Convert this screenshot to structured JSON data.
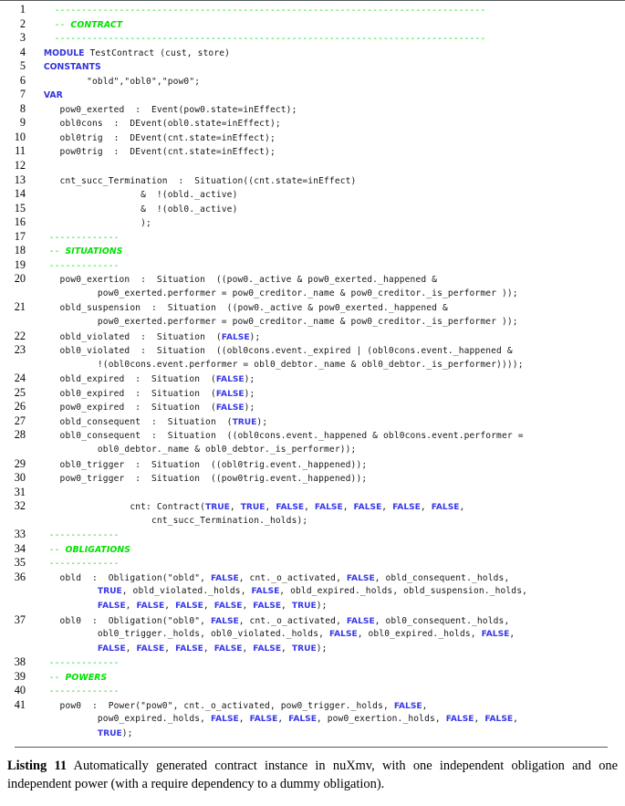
{
  "listing": {
    "language": "nuXmv",
    "colors": {
      "comment": "#00e000",
      "keyword": "#3333dd",
      "boolean": "#3838e8",
      "text": "#161616",
      "rule": "#555a5e",
      "background": "#ffffff"
    },
    "lines": [
      {
        "n": "1",
        "segments": [
          {
            "t": "    ",
            "c": "plain"
          },
          {
            "t": "--------------------------------------------------------------------------------",
            "c": "cmt"
          }
        ]
      },
      {
        "n": "2",
        "segments": [
          {
            "t": "    ",
            "c": "plain"
          },
          {
            "t": "--",
            "c": "cmt"
          },
          {
            "t": " ",
            "c": "plain"
          },
          {
            "t": "CONTRACT",
            "c": "cmt-it"
          }
        ]
      },
      {
        "n": "3",
        "segments": [
          {
            "t": "    ",
            "c": "plain"
          },
          {
            "t": "--------------------------------------------------------------------------------",
            "c": "cmt"
          }
        ]
      },
      {
        "n": "4",
        "segments": [
          {
            "t": "  ",
            "c": "plain"
          },
          {
            "t": "MODULE",
            "c": "kw"
          },
          {
            "t": " TestContract (cust, store)",
            "c": "plain"
          }
        ]
      },
      {
        "n": "5",
        "segments": [
          {
            "t": "  ",
            "c": "plain"
          },
          {
            "t": "CONSTANTS",
            "c": "kw"
          }
        ]
      },
      {
        "n": "6",
        "segments": [
          {
            "t": "          \"obld\",\"obl0\",\"pow0\";",
            "c": "plain"
          }
        ]
      },
      {
        "n": "7",
        "segments": [
          {
            "t": "  ",
            "c": "plain"
          },
          {
            "t": "VAR",
            "c": "kw"
          }
        ]
      },
      {
        "n": "8",
        "segments": [
          {
            "t": "     pow0_exerted  :  Event(pow0.state=inEffect);",
            "c": "plain"
          }
        ]
      },
      {
        "n": "9",
        "segments": [
          {
            "t": "     obl0cons  :  DEvent(obl0.state=inEffect);",
            "c": "plain"
          }
        ]
      },
      {
        "n": "10",
        "segments": [
          {
            "t": "     obl0trig  :  DEvent(cnt.state=inEffect);",
            "c": "plain"
          }
        ]
      },
      {
        "n": "11",
        "segments": [
          {
            "t": "     pow0trig  :  DEvent(cnt.state=inEffect);",
            "c": "plain"
          }
        ]
      },
      {
        "n": "12",
        "segments": [
          {
            "t": "",
            "c": "plain"
          }
        ]
      },
      {
        "n": "13",
        "segments": [
          {
            "t": "     cnt_succ_Termination  :  Situation((cnt.state=inEffect)",
            "c": "plain"
          }
        ]
      },
      {
        "n": "14",
        "segments": [
          {
            "t": "                    &  !(obld._active)",
            "c": "plain"
          }
        ]
      },
      {
        "n": "15",
        "segments": [
          {
            "t": "                    &  !(obl0._active)",
            "c": "plain"
          }
        ]
      },
      {
        "n": "16",
        "segments": [
          {
            "t": "                    );",
            "c": "plain"
          }
        ]
      },
      {
        "n": "17",
        "segments": [
          {
            "t": "   ",
            "c": "plain"
          },
          {
            "t": "-------------",
            "c": "cmt"
          }
        ]
      },
      {
        "n": "18",
        "segments": [
          {
            "t": "   ",
            "c": "plain"
          },
          {
            "t": "--",
            "c": "cmt"
          },
          {
            "t": " ",
            "c": "plain"
          },
          {
            "t": "SITUATIONS",
            "c": "cmt-it"
          }
        ]
      },
      {
        "n": "19",
        "segments": [
          {
            "t": "   ",
            "c": "plain"
          },
          {
            "t": "-------------",
            "c": "cmt"
          }
        ]
      },
      {
        "n": "20",
        "segments": [
          {
            "t": "     pow0_exertion  :  Situation  ((pow0._active & pow0_exerted._happened &",
            "c": "plain"
          }
        ]
      },
      {
        "n": "",
        "segments": [
          {
            "t": "            pow0_exerted.performer = pow0_creditor._name & pow0_creditor._is_performer ));",
            "c": "plain"
          }
        ]
      },
      {
        "n": "21",
        "segments": [
          {
            "t": "     obld_suspension  :  Situation  ((pow0._active & pow0_exerted._happened &",
            "c": "plain"
          }
        ]
      },
      {
        "n": "",
        "segments": [
          {
            "t": "            pow0_exerted.performer = pow0_creditor._name & pow0_creditor._is_performer ));",
            "c": "plain"
          }
        ]
      },
      {
        "n": "22",
        "segments": [
          {
            "t": "     obld_violated  :  Situation  (",
            "c": "plain"
          },
          {
            "t": "FALSE",
            "c": "bool"
          },
          {
            "t": ");",
            "c": "plain"
          }
        ]
      },
      {
        "n": "23",
        "segments": [
          {
            "t": "     obl0_violated  :  Situation  ((obl0cons.event._expired | (obl0cons.event._happened &",
            "c": "plain"
          }
        ]
      },
      {
        "n": "",
        "segments": [
          {
            "t": "            !(obl0cons.event.performer = obl0_debtor._name & obl0_debtor._is_performer))));",
            "c": "plain"
          }
        ]
      },
      {
        "n": "24",
        "segments": [
          {
            "t": "     obld_expired  :  Situation  (",
            "c": "plain"
          },
          {
            "t": "FALSE",
            "c": "bool"
          },
          {
            "t": ");",
            "c": "plain"
          }
        ]
      },
      {
        "n": "25",
        "segments": [
          {
            "t": "     obl0_expired  :  Situation  (",
            "c": "plain"
          },
          {
            "t": "FALSE",
            "c": "bool"
          },
          {
            "t": ");",
            "c": "plain"
          }
        ]
      },
      {
        "n": "26",
        "segments": [
          {
            "t": "     pow0_expired  :  Situation  (",
            "c": "plain"
          },
          {
            "t": "FALSE",
            "c": "bool"
          },
          {
            "t": ");",
            "c": "plain"
          }
        ]
      },
      {
        "n": "27",
        "segments": [
          {
            "t": "     obld_consequent  :  Situation  (",
            "c": "plain"
          },
          {
            "t": "TRUE",
            "c": "bool"
          },
          {
            "t": ");",
            "c": "plain"
          }
        ]
      },
      {
        "n": "28",
        "segments": [
          {
            "t": "     obl0_consequent  :  Situation  ((obl0cons.event._happened & obl0cons.event.performer =",
            "c": "plain"
          }
        ]
      },
      {
        "n": "",
        "segments": [
          {
            "t": "            obl0_debtor._name & obl0_debtor._is_performer));",
            "c": "plain"
          }
        ]
      },
      {
        "n": "29",
        "segments": [
          {
            "t": "     obl0_trigger  :  Situation  ((obl0trig.event._happened));",
            "c": "plain"
          }
        ]
      },
      {
        "n": "30",
        "segments": [
          {
            "t": "     pow0_trigger  :  Situation  ((pow0trig.event._happened));",
            "c": "plain"
          }
        ]
      },
      {
        "n": "31",
        "segments": [
          {
            "t": "",
            "c": "plain"
          }
        ]
      },
      {
        "n": "32",
        "segments": [
          {
            "t": "                  cnt: Contract(",
            "c": "plain"
          },
          {
            "t": "TRUE",
            "c": "bool"
          },
          {
            "t": ", ",
            "c": "plain"
          },
          {
            "t": "TRUE",
            "c": "bool"
          },
          {
            "t": ", ",
            "c": "plain"
          },
          {
            "t": "FALSE",
            "c": "bool"
          },
          {
            "t": ", ",
            "c": "plain"
          },
          {
            "t": "FALSE",
            "c": "bool"
          },
          {
            "t": ", ",
            "c": "plain"
          },
          {
            "t": "FALSE",
            "c": "bool"
          },
          {
            "t": ", ",
            "c": "plain"
          },
          {
            "t": "FALSE",
            "c": "bool"
          },
          {
            "t": ", ",
            "c": "plain"
          },
          {
            "t": "FALSE",
            "c": "bool"
          },
          {
            "t": ",",
            "c": "plain"
          }
        ]
      },
      {
        "n": "",
        "segments": [
          {
            "t": "                      cnt_succ_Termination._holds);",
            "c": "plain"
          }
        ]
      },
      {
        "n": "33",
        "segments": [
          {
            "t": "   ",
            "c": "plain"
          },
          {
            "t": "-------------",
            "c": "cmt"
          }
        ]
      },
      {
        "n": "34",
        "segments": [
          {
            "t": "   ",
            "c": "plain"
          },
          {
            "t": "--",
            "c": "cmt"
          },
          {
            "t": " ",
            "c": "plain"
          },
          {
            "t": "OBLIGATIONS",
            "c": "cmt-it"
          }
        ]
      },
      {
        "n": "35",
        "segments": [
          {
            "t": "   ",
            "c": "plain"
          },
          {
            "t": "-------------",
            "c": "cmt"
          }
        ]
      },
      {
        "n": "36",
        "segments": [
          {
            "t": "     obld  :  Obligation(\"obld\", ",
            "c": "plain"
          },
          {
            "t": "FALSE",
            "c": "bool"
          },
          {
            "t": ", cnt._o_activated, ",
            "c": "plain"
          },
          {
            "t": "FALSE",
            "c": "bool"
          },
          {
            "t": ", obld_consequent._holds,",
            "c": "plain"
          }
        ]
      },
      {
        "n": "",
        "segments": [
          {
            "t": "            ",
            "c": "plain"
          },
          {
            "t": "TRUE",
            "c": "bool"
          },
          {
            "t": ", obld_violated._holds, ",
            "c": "plain"
          },
          {
            "t": "FALSE",
            "c": "bool"
          },
          {
            "t": ", obld_expired._holds, obld_suspension._holds,",
            "c": "plain"
          }
        ]
      },
      {
        "n": "",
        "segments": [
          {
            "t": "            ",
            "c": "plain"
          },
          {
            "t": "FALSE",
            "c": "bool"
          },
          {
            "t": ", ",
            "c": "plain"
          },
          {
            "t": "FALSE",
            "c": "bool"
          },
          {
            "t": ", ",
            "c": "plain"
          },
          {
            "t": "FALSE",
            "c": "bool"
          },
          {
            "t": ", ",
            "c": "plain"
          },
          {
            "t": "FALSE",
            "c": "bool"
          },
          {
            "t": ", ",
            "c": "plain"
          },
          {
            "t": "FALSE",
            "c": "bool"
          },
          {
            "t": ", ",
            "c": "plain"
          },
          {
            "t": "TRUE",
            "c": "bool"
          },
          {
            "t": ");",
            "c": "plain"
          }
        ]
      },
      {
        "n": "37",
        "segments": [
          {
            "t": "     obl0  :  Obligation(\"obl0\", ",
            "c": "plain"
          },
          {
            "t": "FALSE",
            "c": "bool"
          },
          {
            "t": ", cnt._o_activated, ",
            "c": "plain"
          },
          {
            "t": "FALSE",
            "c": "bool"
          },
          {
            "t": ", obl0_consequent._holds,",
            "c": "plain"
          }
        ]
      },
      {
        "n": "",
        "segments": [
          {
            "t": "            obl0_trigger._holds, obl0_violated._holds, ",
            "c": "plain"
          },
          {
            "t": "FALSE",
            "c": "bool"
          },
          {
            "t": ", obl0_expired._holds, ",
            "c": "plain"
          },
          {
            "t": "FALSE",
            "c": "bool"
          },
          {
            "t": ",",
            "c": "plain"
          }
        ]
      },
      {
        "n": "",
        "segments": [
          {
            "t": "            ",
            "c": "plain"
          },
          {
            "t": "FALSE",
            "c": "bool"
          },
          {
            "t": ", ",
            "c": "plain"
          },
          {
            "t": "FALSE",
            "c": "bool"
          },
          {
            "t": ", ",
            "c": "plain"
          },
          {
            "t": "FALSE",
            "c": "bool"
          },
          {
            "t": ", ",
            "c": "plain"
          },
          {
            "t": "FALSE",
            "c": "bool"
          },
          {
            "t": ", ",
            "c": "plain"
          },
          {
            "t": "FALSE",
            "c": "bool"
          },
          {
            "t": ", ",
            "c": "plain"
          },
          {
            "t": "TRUE",
            "c": "bool"
          },
          {
            "t": ");",
            "c": "plain"
          }
        ]
      },
      {
        "n": "38",
        "segments": [
          {
            "t": "   ",
            "c": "plain"
          },
          {
            "t": "-------------",
            "c": "cmt"
          }
        ]
      },
      {
        "n": "39",
        "segments": [
          {
            "t": "   ",
            "c": "plain"
          },
          {
            "t": "--",
            "c": "cmt"
          },
          {
            "t": " ",
            "c": "plain"
          },
          {
            "t": "POWERS",
            "c": "cmt-it"
          }
        ]
      },
      {
        "n": "40",
        "segments": [
          {
            "t": "   ",
            "c": "plain"
          },
          {
            "t": "-------------",
            "c": "cmt"
          }
        ]
      },
      {
        "n": "41",
        "segments": [
          {
            "t": "     pow0  :  Power(\"pow0\", cnt._o_activated, pow0_trigger._holds, ",
            "c": "plain"
          },
          {
            "t": "FALSE",
            "c": "bool"
          },
          {
            "t": ",",
            "c": "plain"
          }
        ]
      },
      {
        "n": "",
        "segments": [
          {
            "t": "            pow0_expired._holds, ",
            "c": "plain"
          },
          {
            "t": "FALSE",
            "c": "bool"
          },
          {
            "t": ", ",
            "c": "plain"
          },
          {
            "t": "FALSE",
            "c": "bool"
          },
          {
            "t": ", ",
            "c": "plain"
          },
          {
            "t": "FALSE",
            "c": "bool"
          },
          {
            "t": ", pow0_exertion._holds, ",
            "c": "plain"
          },
          {
            "t": "FALSE",
            "c": "bool"
          },
          {
            "t": ", ",
            "c": "plain"
          },
          {
            "t": "FALSE",
            "c": "bool"
          },
          {
            "t": ",",
            "c": "plain"
          }
        ]
      },
      {
        "n": "",
        "segments": [
          {
            "t": "            ",
            "c": "plain"
          },
          {
            "t": "TRUE",
            "c": "bool"
          },
          {
            "t": ");",
            "c": "plain"
          }
        ]
      }
    ]
  },
  "caption": {
    "label": "Listing 11",
    "text": " Automatically generated contract instance in nuXmv, with one independent obligation and one independent power (with a require dependency to a dummy obligation)."
  }
}
